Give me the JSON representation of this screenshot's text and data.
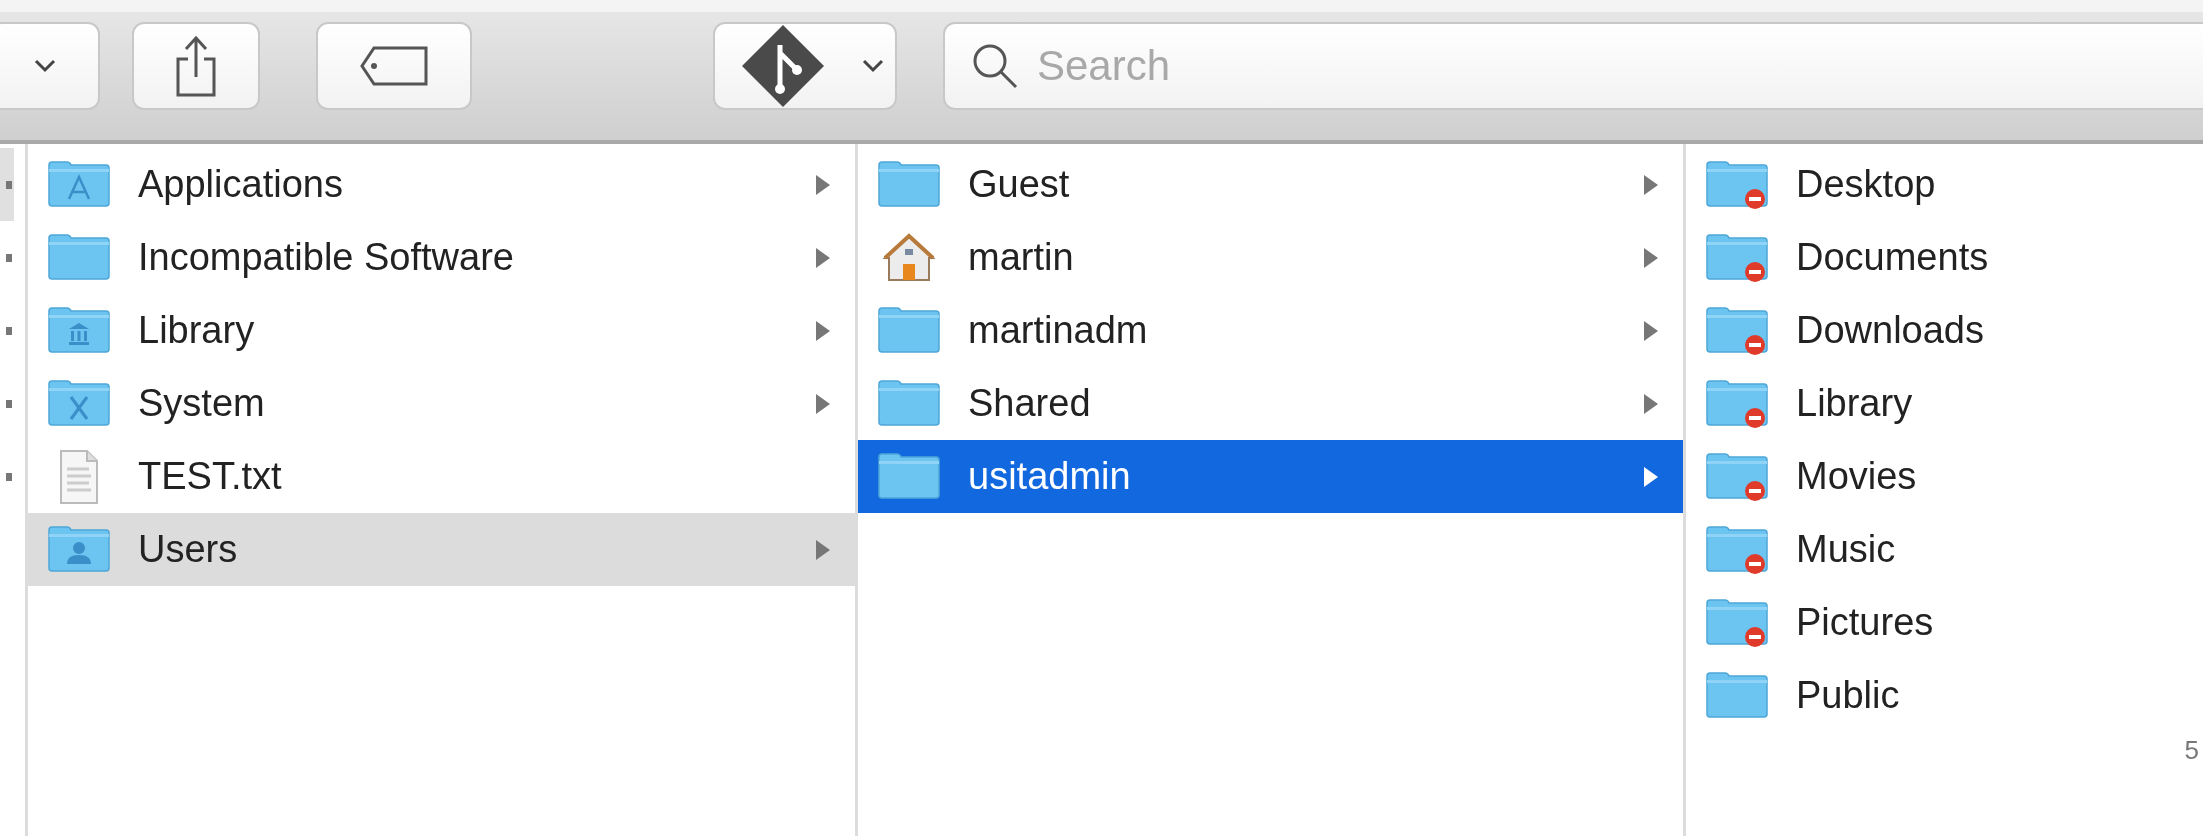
{
  "toolbar": {
    "search": {
      "placeholder": "Search"
    }
  },
  "columns": [
    {
      "items": [
        {
          "name": "Applications",
          "kind": "apps-folder",
          "expandable": true,
          "selected": false,
          "focused": false
        },
        {
          "name": "Incompatible Software",
          "kind": "folder",
          "expandable": true,
          "selected": false,
          "focused": false
        },
        {
          "name": "Library",
          "kind": "library-folder",
          "expandable": true,
          "selected": false,
          "focused": false
        },
        {
          "name": "System",
          "kind": "system-folder",
          "expandable": true,
          "selected": false,
          "focused": false
        },
        {
          "name": "TEST.txt",
          "kind": "document",
          "expandable": false,
          "selected": false,
          "focused": false
        },
        {
          "name": "Users",
          "kind": "users-folder",
          "expandable": true,
          "selected": true,
          "focused": false
        }
      ]
    },
    {
      "items": [
        {
          "name": "Guest",
          "kind": "folder",
          "expandable": true,
          "selected": false,
          "focused": false
        },
        {
          "name": "martin",
          "kind": "home",
          "expandable": true,
          "selected": false,
          "focused": false
        },
        {
          "name": "martinadm",
          "kind": "folder",
          "expandable": true,
          "selected": false,
          "focused": false
        },
        {
          "name": "Shared",
          "kind": "folder",
          "expandable": true,
          "selected": false,
          "focused": false
        },
        {
          "name": "usitadmin",
          "kind": "folder",
          "expandable": true,
          "selected": true,
          "focused": true
        }
      ]
    },
    {
      "items": [
        {
          "name": "Desktop",
          "kind": "restricted-folder",
          "expandable": false,
          "selected": false,
          "focused": false
        },
        {
          "name": "Documents",
          "kind": "restricted-folder",
          "expandable": false,
          "selected": false,
          "focused": false
        },
        {
          "name": "Downloads",
          "kind": "restricted-folder",
          "expandable": false,
          "selected": false,
          "focused": false
        },
        {
          "name": "Library",
          "kind": "restricted-folder",
          "expandable": false,
          "selected": false,
          "focused": false
        },
        {
          "name": "Movies",
          "kind": "restricted-folder",
          "expandable": false,
          "selected": false,
          "focused": false
        },
        {
          "name": "Music",
          "kind": "restricted-folder",
          "expandable": false,
          "selected": false,
          "focused": false
        },
        {
          "name": "Pictures",
          "kind": "restricted-folder",
          "expandable": false,
          "selected": false,
          "focused": false
        },
        {
          "name": "Public",
          "kind": "folder",
          "expandable": false,
          "selected": false,
          "focused": false
        }
      ]
    }
  ],
  "page_number": "5"
}
